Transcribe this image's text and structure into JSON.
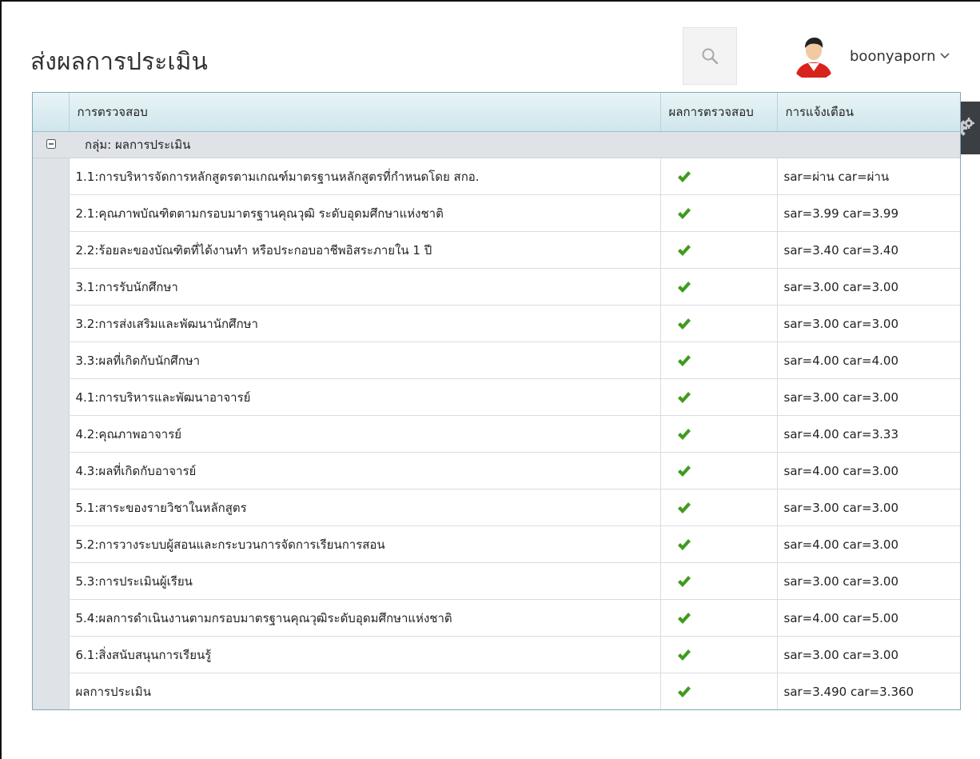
{
  "header": {
    "title": "ส่งผลการประเมิน",
    "user_name": "boonyaporn",
    "icons": {
      "search": "search-icon",
      "user_menu": "chevron-down-icon",
      "settings": "gear-icon"
    }
  },
  "grid": {
    "columns": [
      "การตรวจสอบ",
      "ผลการตรวจสอบ",
      "การแจ้งเตือน"
    ],
    "group_label": "กลุ่ม: ผลการประเมิน",
    "rows": [
      {
        "check": "1.1:การบริหารจัดการหลักสูตรตามเกณฑ์มาตรฐานหลักสูตรที่กำหนดโดย สกอ.",
        "result": "check-icon",
        "notify": "sar=ผ่าน car=ผ่าน"
      },
      {
        "check": "2.1:คุณภาพบัณฑิตตามกรอบมาตรฐานคุณวุฒิ ระดับอุดมศึกษาแห่งชาติ",
        "result": "check-icon",
        "notify": "sar=3.99 car=3.99"
      },
      {
        "check": "2.2:ร้อยละของบัณฑิตที่ได้งานทำ หรือประกอบอาชีพอิสระภายใน 1 ปี",
        "result": "check-icon",
        "notify": "sar=3.40 car=3.40"
      },
      {
        "check": "3.1:การรับนักศึกษา",
        "result": "check-icon",
        "notify": "sar=3.00 car=3.00"
      },
      {
        "check": "3.2:การส่งเสริมและพัฒนานักศึกษา",
        "result": "check-icon",
        "notify": "sar=3.00 car=3.00"
      },
      {
        "check": "3.3:ผลที่เกิดกับนักศึกษา",
        "result": "check-icon",
        "notify": "sar=4.00 car=4.00"
      },
      {
        "check": "4.1:การบริหารและพัฒนาอาจารย์",
        "result": "check-icon",
        "notify": "sar=3.00 car=3.00"
      },
      {
        "check": "4.2:คุณภาพอาจารย์",
        "result": "check-icon",
        "notify": "sar=4.00 car=3.33"
      },
      {
        "check": "4.3:ผลที่เกิดกับอาจารย์",
        "result": "check-icon",
        "notify": "sar=4.00 car=3.00"
      },
      {
        "check": "5.1:สาระของรายวิชาในหลักสูตร",
        "result": "check-icon",
        "notify": "sar=3.00 car=3.00"
      },
      {
        "check": "5.2:การวางระบบผู้สอนและกระบวนการจัดการเรียนการสอน",
        "result": "check-icon",
        "notify": "sar=4.00 car=3.00"
      },
      {
        "check": "5.3:การประเมินผู้เรียน",
        "result": "check-icon",
        "notify": "sar=3.00 car=3.00"
      },
      {
        "check": "5.4:ผลการดำเนินงานตามกรอบมาตรฐานคุณวุฒิระดับอุดมศึกษาแห่งชาติ",
        "result": "check-icon",
        "notify": "sar=4.00 car=5.00"
      },
      {
        "check": "6.1:สิ่งสนับสนุนการเรียนรู้",
        "result": "check-icon",
        "notify": "sar=3.00 car=3.00"
      },
      {
        "check": "ผลการประเมิน",
        "result": "check-icon",
        "notify": "sar=3.490 car=3.360"
      }
    ]
  },
  "colors": {
    "check": "#3f9b1f",
    "header_bg": "#d6eaef",
    "group_bg": "#dfe2e6",
    "gear_tab_bg": "#3b3e43"
  }
}
